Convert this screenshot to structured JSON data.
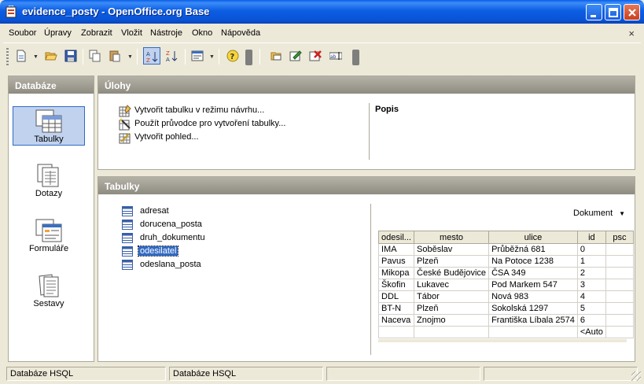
{
  "window": {
    "title": "evidence_posty - OpenOffice.org Base"
  },
  "menu": {
    "items": [
      "Soubor",
      "Úpravy",
      "Zobrazit",
      "Vložit",
      "Nástroje",
      "Okno",
      "Nápověda"
    ],
    "close_glyph": "×"
  },
  "toolbar": {
    "icons": [
      "new-icon",
      "open-icon",
      "save-icon",
      "copy-icon",
      "paste-icon",
      "sort-ascending-icon",
      "sort-descending-icon",
      "form-icon",
      "help-icon",
      "open-db-object-icon",
      "edit-icon",
      "delete-icon",
      "rename-icon"
    ]
  },
  "database": {
    "header": "Databáze",
    "items": [
      {
        "label": "Tabulky",
        "icon": "tables-icon",
        "selected": true
      },
      {
        "label": "Dotazy",
        "icon": "queries-icon",
        "selected": false
      },
      {
        "label": "Formuláře",
        "icon": "forms-icon",
        "selected": false
      },
      {
        "label": "Sestavy",
        "icon": "reports-icon",
        "selected": false
      }
    ]
  },
  "tasks": {
    "header": "Úlohy",
    "items": [
      {
        "label": "Vytvořit tabulku v režimu návrhu...",
        "icon": "design-table-icon"
      },
      {
        "label": "Použít průvodce pro vytvoření tabulky...",
        "icon": "wizard-icon"
      },
      {
        "label": "Vytvořit pohled...",
        "icon": "view-icon"
      }
    ],
    "description_label": "Popis"
  },
  "tables": {
    "header": "Tabulky",
    "items": [
      {
        "label": "adresat",
        "selected": false
      },
      {
        "label": "dorucena_posta",
        "selected": false
      },
      {
        "label": "druh_dokumentu",
        "selected": false
      },
      {
        "label": "odesilatel",
        "selected": true
      },
      {
        "label": "odeslana_posta",
        "selected": false
      }
    ],
    "preview_select": "Dokument",
    "grid": {
      "columns": [
        "odesil...",
        "mesto",
        "ulice",
        "id",
        "psc"
      ],
      "rows": [
        [
          "IMA",
          "Soběslav",
          "Průběžná 681",
          "0",
          ""
        ],
        [
          "Pavus",
          "Plzeň",
          "Na Potoce 1238",
          "1",
          ""
        ],
        [
          "Mikopa",
          "České Budějovice",
          "ČSA 349",
          "2",
          ""
        ],
        [
          "Škofin",
          "Lukavec",
          "Pod Markem 547",
          "3",
          ""
        ],
        [
          "DDL",
          "Tábor",
          "Nová 983",
          "4",
          ""
        ],
        [
          "BT-N",
          "Plzeň",
          "Sokolská 1297",
          "5",
          ""
        ],
        [
          "Naceva",
          "Znojmo",
          "Františka Líbala 2574",
          "6",
          ""
        ],
        [
          "",
          "",
          "",
          "<Auto",
          ""
        ]
      ]
    }
  },
  "statusbar": {
    "cells": [
      "Databáze HSQL",
      "Databáze HSQL",
      "",
      ""
    ]
  },
  "colors": {
    "titlebar": "#0a53d6",
    "selection": "#316ac5",
    "panel_header": "#8e8b80"
  }
}
